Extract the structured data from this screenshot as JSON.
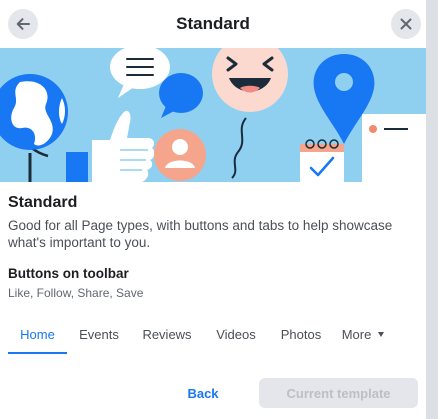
{
  "dialog": {
    "title": "Standard",
    "back_icon": "arrow-left-icon",
    "close_icon": "close-icon"
  },
  "colors": {
    "accent": "#1877f2",
    "hero_background": "#8fd0f1",
    "button_disabled_bg": "#e4e6eb"
  },
  "template": {
    "name": "Standard",
    "description": "Good for all Page types, with buttons and tabs to help showcase what's important to you.",
    "toolbar_heading": "Buttons on toolbar",
    "toolbar_buttons": "Like, Follow, Share, Save"
  },
  "tabs": [
    {
      "label": "Home",
      "active": true
    },
    {
      "label": "Events",
      "active": false
    },
    {
      "label": "Reviews",
      "active": false
    },
    {
      "label": "Videos",
      "active": false
    },
    {
      "label": "Photos",
      "active": false
    },
    {
      "label": "More",
      "active": false,
      "icon": "caret-down-icon"
    }
  ],
  "footer": {
    "back_label": "Back",
    "current_label": "Current template"
  }
}
